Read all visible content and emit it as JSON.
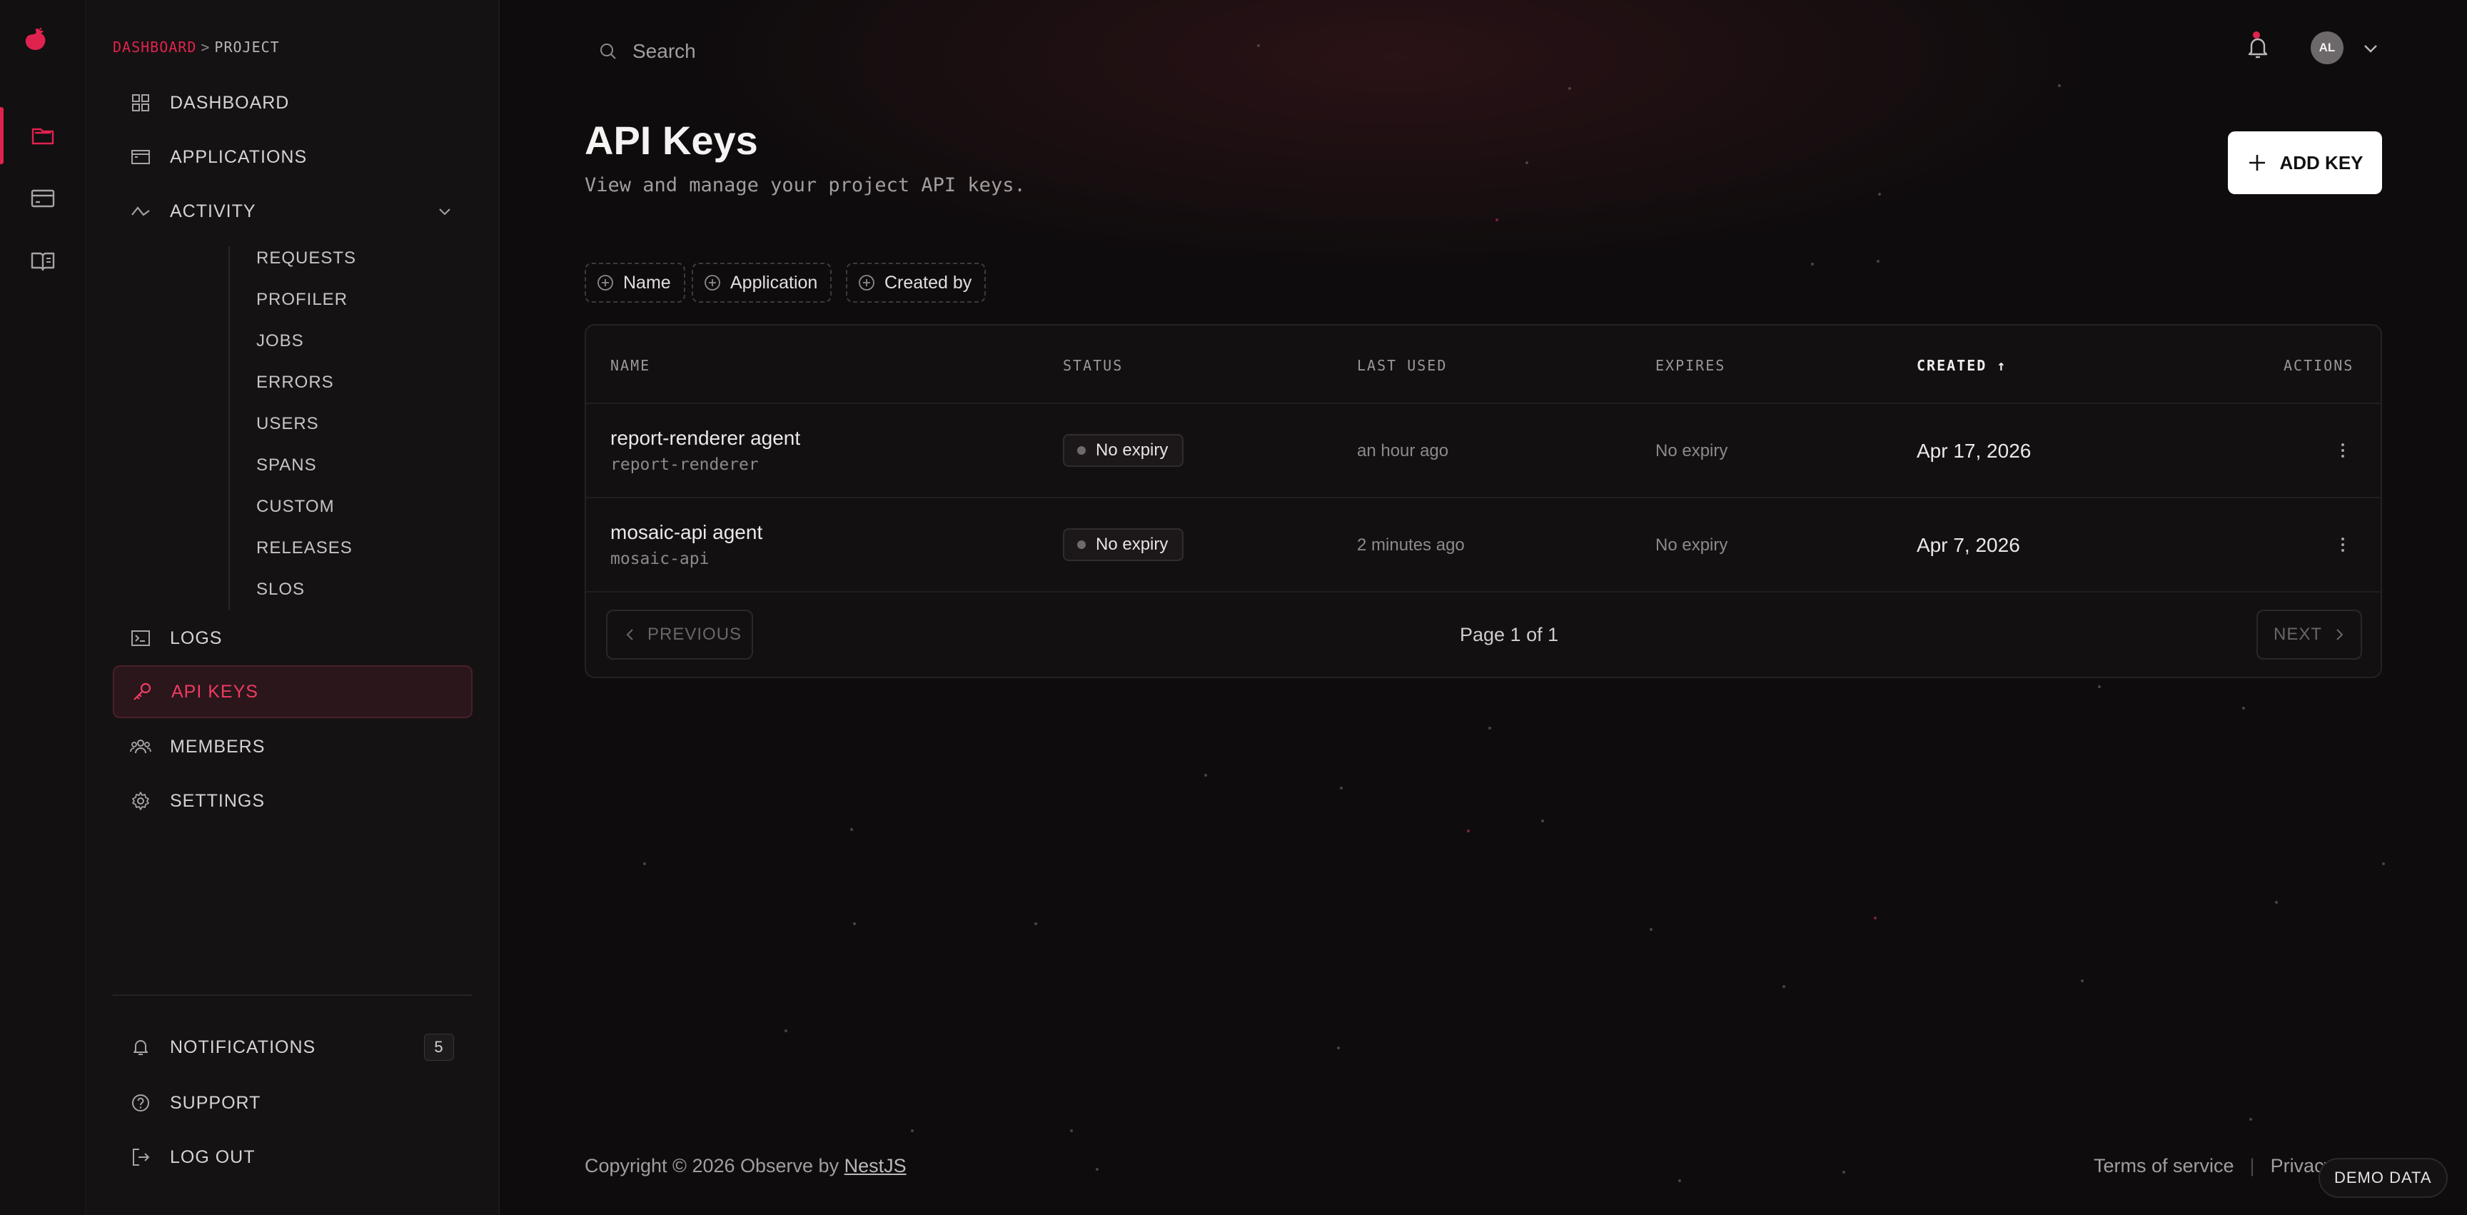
{
  "app": {
    "brand_color": "#e0234e"
  },
  "rail": {
    "items": [
      {
        "icon": "folder-icon",
        "active": true
      },
      {
        "icon": "card-icon",
        "active": false
      },
      {
        "icon": "book-icon",
        "active": false
      }
    ]
  },
  "breadcrumb": {
    "root": "DASHBOARD",
    "separator": ">",
    "current": "PROJECT"
  },
  "sidebar": {
    "items": {
      "dashboard": "DASHBOARD",
      "applications": "APPLICATIONS",
      "activity": "ACTIVITY",
      "logs": "LOGS",
      "api_keys": "API KEYS",
      "members": "MEMBERS",
      "settings": "SETTINGS"
    },
    "activity_sub": [
      "REQUESTS",
      "PROFILER",
      "JOBS",
      "ERRORS",
      "USERS",
      "SPANS",
      "CUSTOM",
      "RELEASES",
      "SLOS"
    ],
    "bottom": {
      "notifications": "NOTIFICATIONS",
      "notifications_count": "5",
      "support": "SUPPORT",
      "logout": "LOG OUT"
    }
  },
  "header": {
    "search_placeholder": "Search",
    "avatar_initials": "AL"
  },
  "page": {
    "title": "API Keys",
    "subtitle": "View and manage your project API keys.",
    "add_button": "ADD KEY"
  },
  "filters": [
    "Name",
    "Application",
    "Created by"
  ],
  "table": {
    "columns": {
      "name": "NAME",
      "status": "STATUS",
      "last_used": "LAST USED",
      "expires": "EXPIRES",
      "created": "CREATED",
      "created_sort": "↑",
      "actions": "ACTIONS"
    },
    "rows": [
      {
        "name": "report-renderer agent",
        "slug": "report-renderer",
        "status": "No expiry",
        "last_used": "an hour ago",
        "expires": "No expiry",
        "created": "Apr 17, 2026"
      },
      {
        "name": "mosaic-api agent",
        "slug": "mosaic-api",
        "status": "No expiry",
        "last_used": "2 minutes ago",
        "expires": "No expiry",
        "created": "Apr 7, 2026"
      }
    ],
    "pagination": {
      "previous": "PREVIOUS",
      "page_info": "Page 1 of 1",
      "next": "NEXT"
    }
  },
  "footer": {
    "copyright": "Copyright © 2026 Observe by ",
    "copyright_link": "NestJS",
    "terms": "Terms of service",
    "privacy": "Privacy"
  },
  "demo_badge": "DEMO DATA"
}
